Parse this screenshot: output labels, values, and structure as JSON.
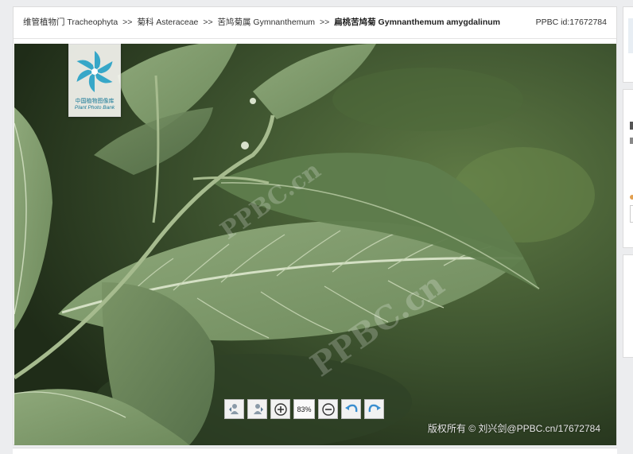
{
  "breadcrumb": {
    "items": [
      {
        "label": "维管植物门 Tracheophyta"
      },
      {
        "label": "菊科 Asteraceae"
      },
      {
        "label": "苦鸠菊属 Gymnanthemum"
      }
    ],
    "separator": ">>",
    "current": "扁桃苦鸠菊 Gymnanthemum amygdalinum"
  },
  "ppbc_id": "PPBC id:17672784",
  "logo": {
    "name_cn": "中国植物图像库",
    "name_en": "Plant Photo Bank"
  },
  "watermark_text": "PPBC.cn",
  "toolbar": {
    "buttons": [
      {
        "icon": "rotate-left-person-icon"
      },
      {
        "icon": "rotate-right-person-icon"
      },
      {
        "icon": "zoom-in-icon"
      },
      {
        "icon": "zoom-level"
      },
      {
        "icon": "zoom-out-icon"
      },
      {
        "icon": "rotate-left-icon"
      },
      {
        "icon": "rotate-right-icon"
      }
    ],
    "zoom_level": "83%"
  },
  "copyright": "版权所有 © 刘兴剑@PPBC.cn/17672784",
  "colors": {
    "page_bg": "#ecedef",
    "leaf": "#7f9b6a",
    "leaf_vein": "#c9d8b8",
    "logo_teal": "#1a7a98"
  }
}
